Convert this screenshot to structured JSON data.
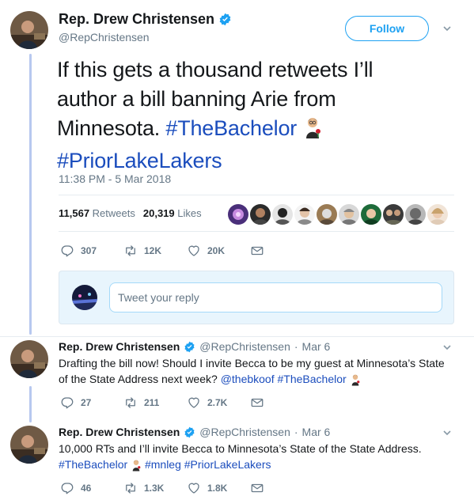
{
  "main_tweet": {
    "name": "Rep. Drew Christensen",
    "handle": "@RepChristensen",
    "follow_label": "Follow",
    "text_part1": "If this gets a thousand retweets I’ll author a bill banning Arie from Minnesota. ",
    "hashtag1": "#TheBachelor",
    "hashtag2": "#PriorLakeLakers",
    "timestamp": "11:38 PM - 5 Mar 2018",
    "retweets_count": "11,567",
    "retweets_label": "Retweets",
    "likes_count": "20,319",
    "likes_label": "Likes",
    "actions": {
      "replies": "307",
      "retweets": "12K",
      "likes": "20K"
    }
  },
  "reply_box": {
    "placeholder": "Tweet your reply"
  },
  "replies": [
    {
      "name": "Rep. Drew Christensen",
      "handle": "@RepChristensen",
      "dot": "·",
      "date": "Mar 6",
      "text": "Drafting the bill now! Should I invite Becca to be my guest at Minnesota’s State of the State Address next week? ",
      "mention": "@thebkoof",
      "hashtag": "#TheBachelor",
      "actions": {
        "replies": "27",
        "retweets": "211",
        "likes": "2.7K"
      }
    },
    {
      "name": "Rep. Drew Christensen",
      "handle": "@RepChristensen",
      "dot": "·",
      "date": "Mar 6",
      "text": "10,000 RTs and I’ll invite Becca to Minnesota’s State of the State Address. ",
      "hashtag": "#TheBachelor",
      "hashtag2": "#mnleg",
      "hashtag3": "#PriorLakeLakers",
      "actions": {
        "replies": "46",
        "retweets": "1.3K",
        "likes": "1.8K"
      }
    }
  ],
  "colors": {
    "accent": "#1da1f2",
    "hashtag": "#1b4dbd",
    "muted": "#657786",
    "thread_line": "#b7c8ef"
  }
}
